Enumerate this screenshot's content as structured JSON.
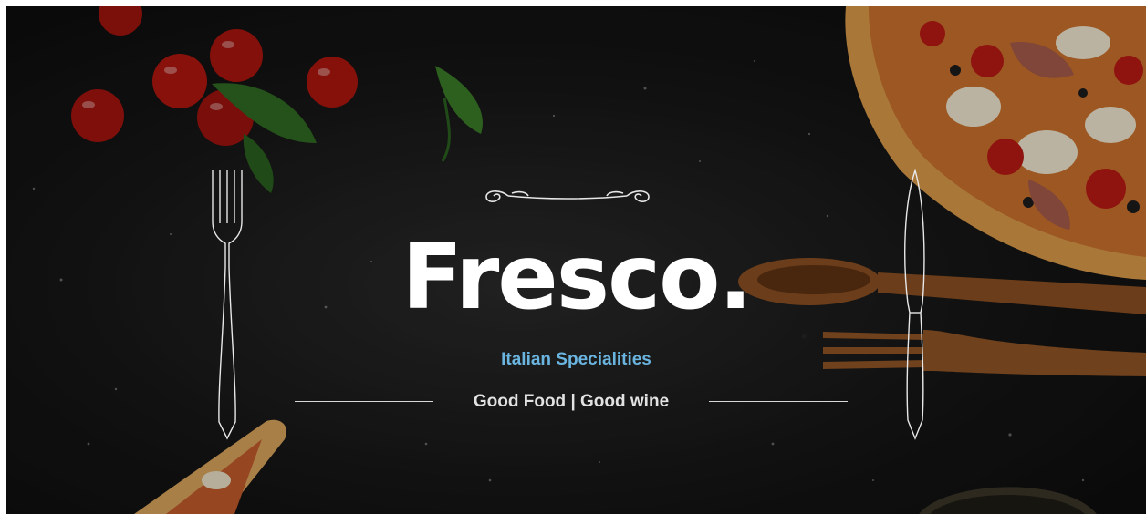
{
  "hero": {
    "title": "Fresco.",
    "subtitle": "Italian Specialities",
    "tagline": "Good Food | Good wine"
  },
  "colors": {
    "subtitle": "#6ab4e0",
    "title": "#ffffff",
    "background": "#151515"
  },
  "icons": {
    "ornament": "scroll-ornament-icon",
    "fork": "fork-outline-icon",
    "knife": "knife-outline-icon"
  }
}
